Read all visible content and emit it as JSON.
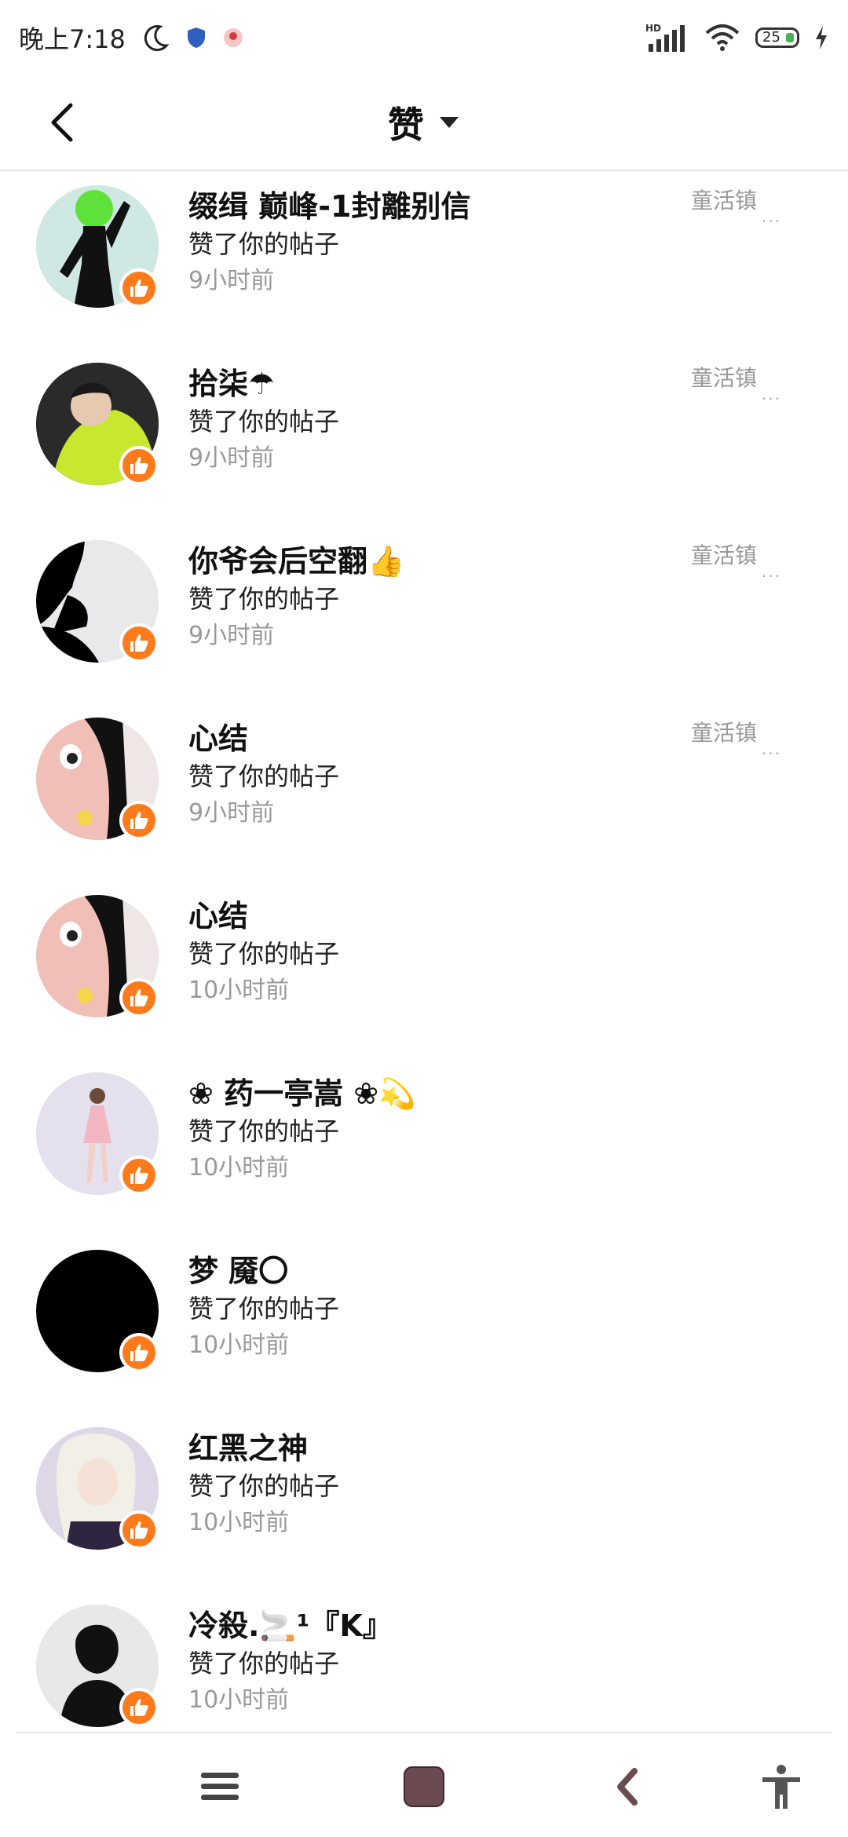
{
  "status_bar": {
    "time": "晚上7:18",
    "network_label": "HD",
    "battery": "25"
  },
  "header": {
    "title": "赞"
  },
  "items": [
    {
      "username": "缀缉 巅峰-1封離别信",
      "action": "赞了你的帖子",
      "time": "9小时前",
      "side_label": "童活镇",
      "dots": "..."
    },
    {
      "username": "拾柒☂",
      "action": "赞了你的帖子",
      "time": "9小时前",
      "side_label": "童活镇",
      "dots": "..."
    },
    {
      "username": "你爷会后空翻👍",
      "action": "赞了你的帖子",
      "time": "9小时前",
      "side_label": "童活镇",
      "dots": "..."
    },
    {
      "username": "心结",
      "action": "赞了你的帖子",
      "time": "9小时前",
      "side_label": "童活镇",
      "dots": "..."
    },
    {
      "username": "心结",
      "action": "赞了你的帖子",
      "time": "10小时前",
      "side_label": "",
      "dots": ""
    },
    {
      "username": "❀ 药一亭嵩 ❀💫",
      "action": "赞了你的帖子",
      "time": "10小时前",
      "side_label": "",
      "dots": ""
    },
    {
      "username": "梦 魇〇",
      "action": "赞了你的帖子",
      "time": "10小时前",
      "side_label": "",
      "dots": ""
    },
    {
      "username": "红黑之神",
      "action": "赞了你的帖子",
      "time": "10小时前",
      "side_label": "",
      "dots": ""
    },
    {
      "username": "冷殺.🚬¹『K』",
      "action": "赞了你的帖子",
      "time": "10小时前",
      "side_label": "",
      "dots": ""
    }
  ],
  "colors": {
    "accent": "#ff7a1a",
    "secondary_text": "#999999",
    "nav_icon": "#444444",
    "home_square": "#6b4a52"
  },
  "icons": {
    "back": "chevron-left-icon",
    "dropdown": "triangle-down-icon",
    "like": "thumbs-up-icon",
    "nav_menu": "hamburger-icon",
    "nav_home": "square-icon",
    "nav_back": "chevron-left-icon",
    "nav_accessibility": "accessibility-icon"
  }
}
